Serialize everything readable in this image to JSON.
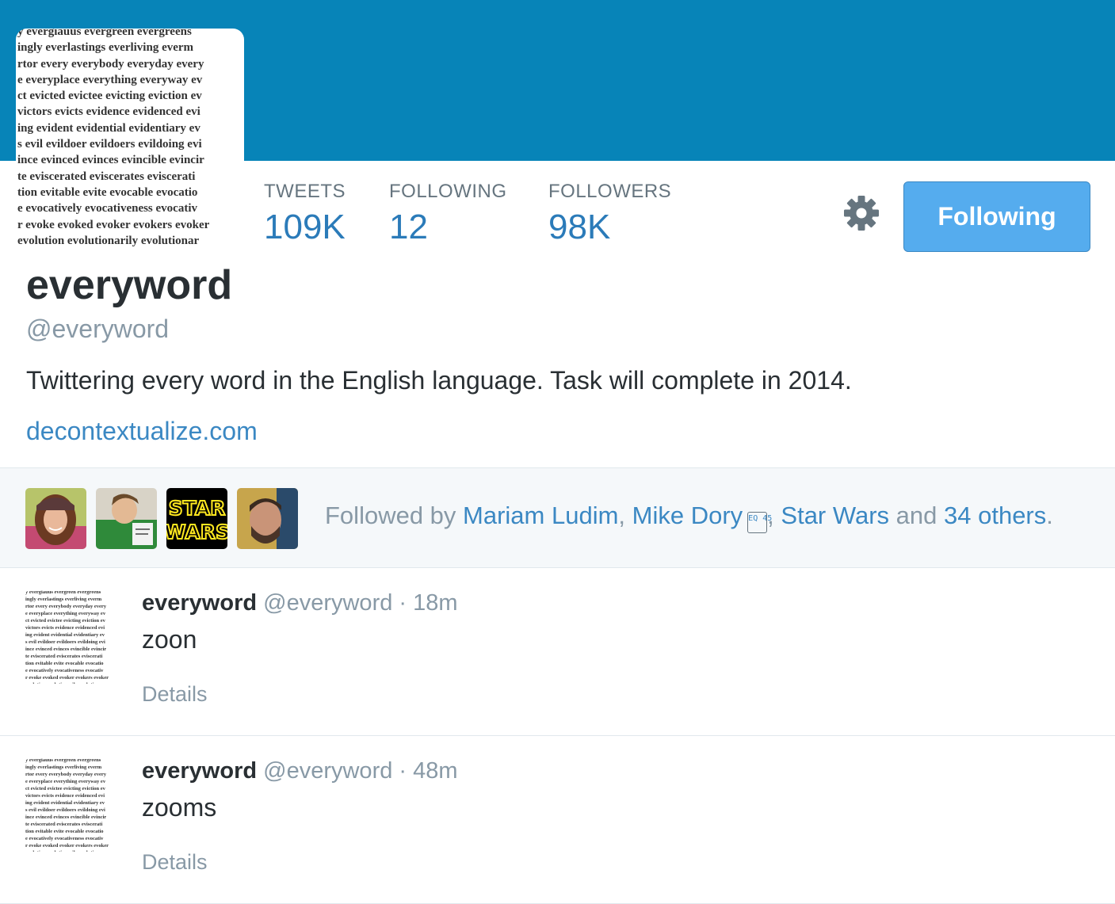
{
  "colors": {
    "banner": "#0784b8",
    "link": "#3b88c3",
    "accent_button": "#55acee",
    "muted": "#8899a6"
  },
  "profile_image_text": [
    "y evergiauus evergreen evergreens",
    "ingly everlastings everliving everm",
    "rtor every everybody everyday every",
    "e everyplace everything everyway ev",
    "ct evicted evictee evicting eviction ev",
    "victors evicts evidence evidenced evi",
    "ing evident evidential evidentiary ev",
    "s evil evildoer evildoers evildoing evi",
    "ince evinced evinces evincible evincir",
    "te eviscerated eviscerates eviscerati",
    "tion evitable evite evocable evocatio",
    "e evocatively evocativeness evocativ",
    "r evoke evoked evoker evokers evoker",
    "evolution evolutionarily evolutionar"
  ],
  "stats": [
    {
      "label": "TWEETS",
      "value": "109K"
    },
    {
      "label": "FOLLOWING",
      "value": "12"
    },
    {
      "label": "FOLLOWERS",
      "value": "98K"
    }
  ],
  "settings_icon": "gear-icon",
  "follow_button": {
    "label": "Following"
  },
  "profile": {
    "name": "everyword",
    "handle": "@everyword",
    "bio": "Twittering every word in the English language. Task will complete in 2014.",
    "url": "decontextualize.com"
  },
  "followed_by": {
    "prefix": "Followed by ",
    "names": [
      "Mariam Ludim",
      "Mike Dory",
      "Star Wars"
    ],
    "badge": "EQ 45",
    "connector": " and ",
    "others": "34 others",
    "suffix": "."
  },
  "star_wars_logo": [
    "STAR",
    "WARS"
  ],
  "tweets": [
    {
      "name": "everyword",
      "handle": "@everyword",
      "time": "18m",
      "text": "zoon",
      "details": "Details"
    },
    {
      "name": "everyword",
      "handle": "@everyword",
      "time": "48m",
      "text": "zooms",
      "details": "Details"
    }
  ],
  "separator": " · ",
  "comma": ", "
}
